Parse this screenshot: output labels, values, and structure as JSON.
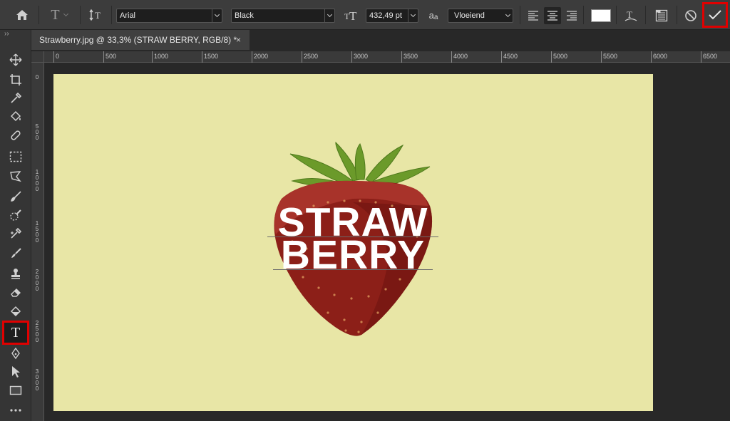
{
  "options_bar": {
    "font_family": "Arial",
    "font_style": "Black",
    "font_size": "432,49 pt",
    "antialias_label": "a",
    "antialias_sub": "a",
    "antialias": "Vloeiend",
    "text_color": "#ffffff",
    "highlight_color": "#e00000"
  },
  "document_tab": {
    "title": "Strawberry.jpg @ 33,3% (STRAW BERRY, RGB/8) *",
    "close": "×"
  },
  "panel_toggle": "››",
  "ruler": {
    "horizontal": [
      "0",
      "500",
      "1000",
      "1500",
      "2000",
      "2500",
      "3000",
      "3500",
      "4000",
      "4500",
      "5000",
      "5500",
      "6000",
      "6500"
    ],
    "vertical": [
      "0",
      "5 0 0",
      "1 0 0 0",
      "1 5 0 0",
      "2 0 0 0",
      "2 5 0 0",
      "3 0 0 0"
    ]
  },
  "canvas": {
    "background": "#e8e6a6",
    "text_line1": "STRAW",
    "text_line2": "BERRY"
  }
}
